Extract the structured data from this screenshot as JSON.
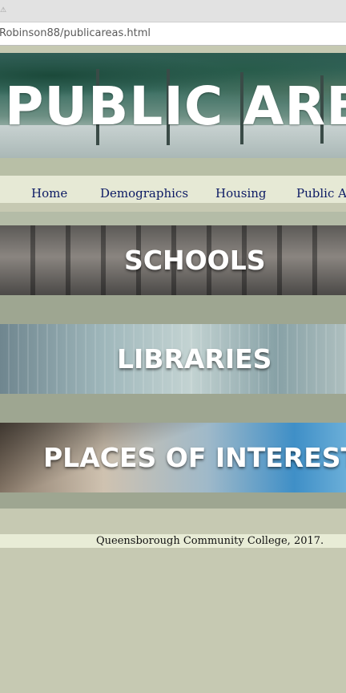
{
  "browser": {
    "url": "Robinson88/publicareas.html"
  },
  "banner": {
    "title": "PUBLIC AREAS"
  },
  "nav": {
    "items": [
      "Home",
      "Demographics",
      "Housing",
      "Public Ar"
    ]
  },
  "sections": [
    {
      "label": "SCHOOLS"
    },
    {
      "label": "LIBRARIES"
    },
    {
      "label": "PLACES OF INTEREST"
    }
  ],
  "footer": {
    "text": "Queensborough Community College, 2017."
  },
  "colors": {
    "page_background": "#c6c9b2",
    "nav_background": "#e6e9d5",
    "nav_link": "#0c1a64",
    "banner_text": "#ffffff"
  },
  "icons": [
    "warning-icon"
  ]
}
